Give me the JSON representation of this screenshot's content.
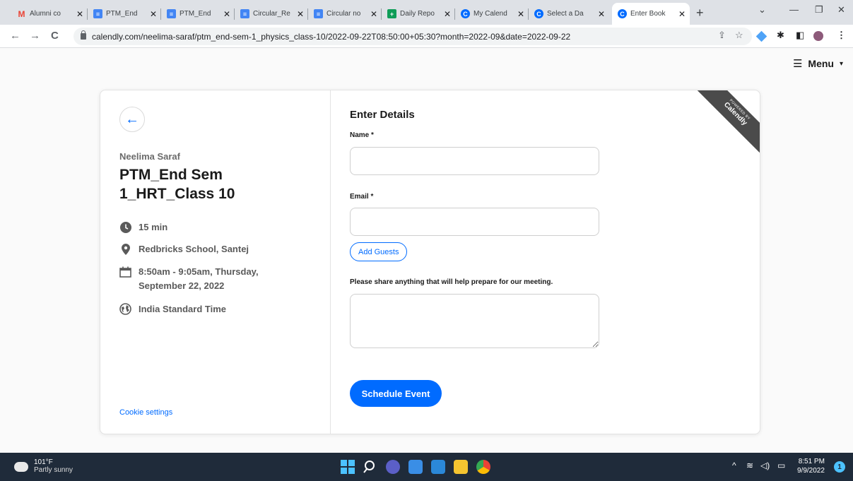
{
  "browser": {
    "tabs": [
      {
        "title": "Alumni co",
        "icon": "gmail-icon",
        "color": "#ea4335"
      },
      {
        "title": "PTM_End",
        "icon": "docs-icon",
        "color": "#4285f4"
      },
      {
        "title": "PTM_End",
        "icon": "docs-icon",
        "color": "#4285f4"
      },
      {
        "title": "Circular_Re",
        "icon": "docs-icon",
        "color": "#4285f4"
      },
      {
        "title": "Circular no",
        "icon": "docs-icon",
        "color": "#4285f4"
      },
      {
        "title": "Daily Repo",
        "icon": "sheets-icon",
        "color": "#0f9d58"
      },
      {
        "title": "My Calend",
        "icon": "calendly-icon",
        "color": "#006bff"
      },
      {
        "title": "Select a Da",
        "icon": "calendly-icon",
        "color": "#006bff"
      },
      {
        "title": "Enter Book",
        "icon": "calendly-icon",
        "color": "#006bff",
        "active": true
      }
    ],
    "url": "calendly.com/neelima-saraf/ptm_end-sem-1_physics_class-10/2022-09-22T08:50:00+05:30?month=2022-09&date=2022-09-22"
  },
  "page": {
    "menu_label": "Menu",
    "host_name": "Neelima Saraf",
    "event_title": "PTM_End Sem 1_HRT_Class 10",
    "duration": "15 min",
    "location": "Redbricks School, Santej",
    "datetime": "8:50am - 9:05am, Thursday, September 22, 2022",
    "timezone": "India Standard Time",
    "cookie_link": "Cookie settings",
    "form": {
      "heading": "Enter Details",
      "name_label": "Name *",
      "email_label": "Email *",
      "add_guests": "Add Guests",
      "notes_label": "Please share anything that will help prepare for our meeting.",
      "submit": "Schedule Event"
    },
    "ribbon": {
      "top": "POWERED BY",
      "bottom": "Calendly"
    },
    "accent_color": "#006bff"
  },
  "taskbar": {
    "temperature": "101°F",
    "condition": "Partly sunny",
    "time": "8:51 PM",
    "date": "9/9/2022",
    "notification_count": "1"
  }
}
